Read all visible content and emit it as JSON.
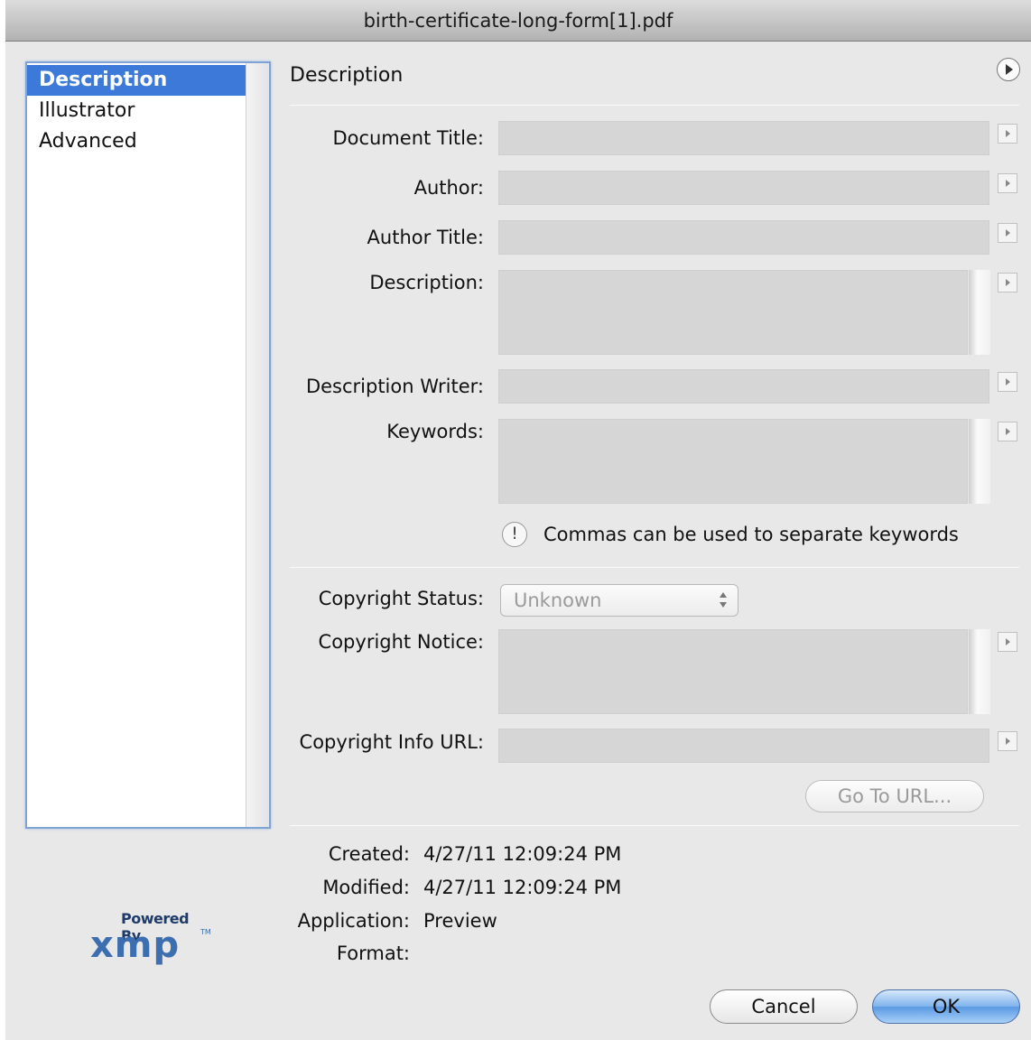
{
  "window": {
    "title": "birth-certificate-long-form[1].pdf"
  },
  "sidebar": {
    "items": [
      {
        "label": "Description",
        "selected": true
      },
      {
        "label": "Illustrator",
        "selected": false
      },
      {
        "label": "Advanced",
        "selected": false
      }
    ]
  },
  "panel": {
    "title": "Description",
    "fields": {
      "document_title": {
        "label": "Document Title:",
        "value": ""
      },
      "author": {
        "label": "Author:",
        "value": ""
      },
      "author_title": {
        "label": "Author Title:",
        "value": ""
      },
      "description": {
        "label": "Description:",
        "value": ""
      },
      "description_writer": {
        "label": "Description Writer:",
        "value": ""
      },
      "keywords": {
        "label": "Keywords:",
        "value": ""
      }
    },
    "keywords_hint": {
      "icon": "!",
      "text": "Commas can be used to separate keywords"
    },
    "copyright_status": {
      "label": "Copyright Status:",
      "value": "Unknown"
    },
    "copyright_notice": {
      "label": "Copyright Notice:",
      "value": ""
    },
    "copyright_url": {
      "label": "Copyright Info URL:",
      "value": ""
    },
    "go_to_url_label": "Go To URL..."
  },
  "file_info": {
    "created": {
      "label": "Created:",
      "value": "4/27/11 12:09:24 PM"
    },
    "modified": {
      "label": "Modified:",
      "value": "4/27/11 12:09:24 PM"
    },
    "application": {
      "label": "Application:",
      "value": "Preview"
    },
    "format": {
      "label": "Format:",
      "value": ""
    }
  },
  "branding": {
    "powered_by": "Powered By",
    "logo": "xmp",
    "tm": "TM"
  },
  "buttons": {
    "cancel": "Cancel",
    "ok": "OK"
  },
  "colors": {
    "selection": "#3c79d8",
    "ok_button": "#5a99e3"
  },
  "icons": {
    "panel_menu": "play-circle-icon",
    "field_dropdown": "triangle-right-icon",
    "hint": "exclamation-icon"
  }
}
